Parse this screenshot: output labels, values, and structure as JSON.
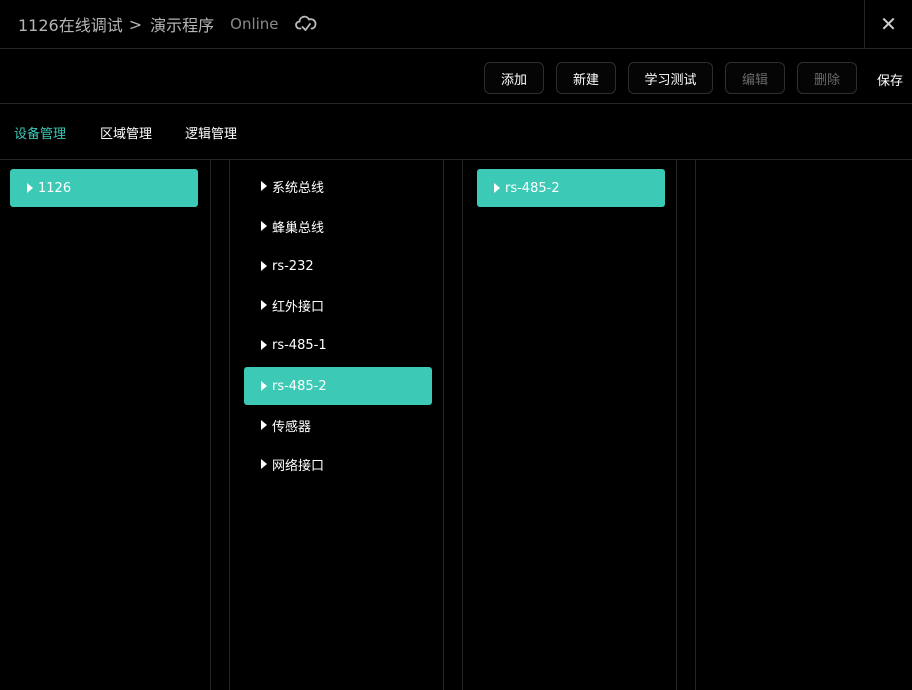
{
  "header": {
    "breadcrumb_root": "1126在线调试",
    "breadcrumb_sep": ">",
    "breadcrumb_current": "演示程序",
    "status": "Online",
    "close_glyph": "✕"
  },
  "toolbar": {
    "add_label": "添加",
    "new_label": "新建",
    "learn_test_label": "学习测试",
    "edit_label": "编辑",
    "delete_label": "删除",
    "save_label": "保存"
  },
  "tabs": [
    {
      "label": "设备管理",
      "active": true
    },
    {
      "label": "区域管理",
      "active": false
    },
    {
      "label": "逻辑管理",
      "active": false
    }
  ],
  "columns": {
    "devices": [
      {
        "label": "1126",
        "selected": true
      }
    ],
    "interfaces": [
      {
        "label": "系统总线",
        "selected": false
      },
      {
        "label": "蜂巢总线",
        "selected": false
      },
      {
        "label": "rs-232",
        "selected": false
      },
      {
        "label": "红外接口",
        "selected": false
      },
      {
        "label": "rs-485-1",
        "selected": false
      },
      {
        "label": "rs-485-2",
        "selected": true
      },
      {
        "label": "传感器",
        "selected": false
      },
      {
        "label": "网络接口",
        "selected": false
      }
    ],
    "sub_items": [
      {
        "label": "rs-485-2",
        "selected": true
      }
    ]
  },
  "colors": {
    "accent": "#3cc9b6",
    "background": "#000000",
    "border": "#262626"
  }
}
